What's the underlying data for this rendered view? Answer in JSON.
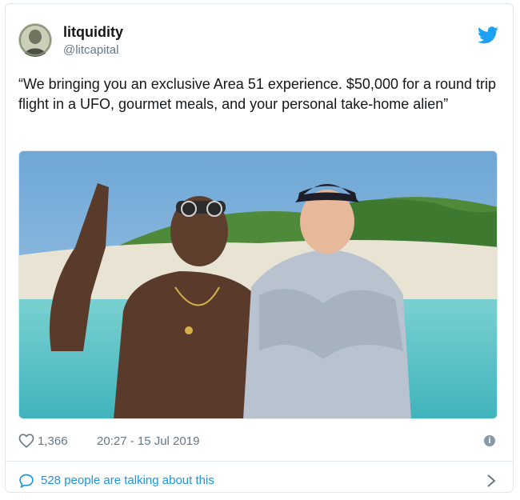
{
  "tweet": {
    "user_name": "litquidity",
    "handle": "@litcapital",
    "text": "“We bringing you an exclusive Area 51 experience. $50,000 for a round trip flight in a UFO, gourmet meals, and your personal take-home alien”",
    "likes": "1,366",
    "timestamp": "20:27 - 15 Jul 2019",
    "talking": "528 people are talking about this",
    "icons": {
      "brand": "twitter-bird-icon",
      "like": "heart-icon",
      "info": "info-icon",
      "conversation": "speech-bubble-icon",
      "more": "chevron-right-icon"
    },
    "colors": {
      "brand_blue": "#1da1f2",
      "link_blue": "#1b95e0",
      "muted_gray": "#657786",
      "border": "#e1e8ed"
    }
  }
}
